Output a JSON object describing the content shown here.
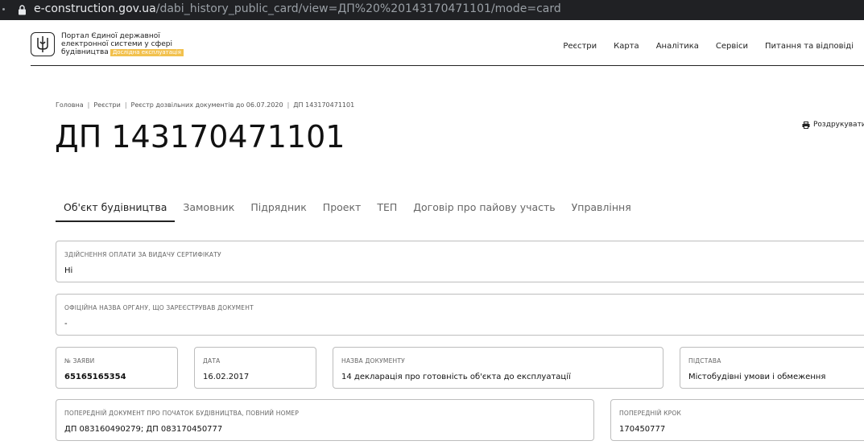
{
  "browser": {
    "url_host": "e-construction.gov.ua",
    "url_path": "/dabi_history_public_card/view=ДП%20%20143170471101/mode=card"
  },
  "header": {
    "portal_line1": "Портал Єдиної державної",
    "portal_line2": "електронної системи у сфері",
    "portal_line3": "будівництва",
    "badge": "Дослідна експлуатація",
    "nav": [
      "Реєстри",
      "Карта",
      "Аналітика",
      "Сервіси",
      "Питання та відповіді"
    ]
  },
  "breadcrumb": [
    "Головна",
    "Реєстри",
    "Реєстр дозвільних документів до 06.07.2020",
    "ДП 143170471101"
  ],
  "page": {
    "title": "ДП 143170471101",
    "print_label": "Роздрукувати"
  },
  "tabs": [
    "Об'єкт будівництва",
    "Замовник",
    "Підрядник",
    "Проект",
    "ТЕП",
    "Договір про пайову участь",
    "Управління"
  ],
  "fields": {
    "payment": {
      "label": "Здійснення оплати за видачу сертифікату",
      "value": "Ні"
    },
    "authority": {
      "label": "Офіційна назва органу, що зареєстрував документ",
      "value": "-"
    },
    "app_no": {
      "label": "№ заяви",
      "value": "65165165354"
    },
    "date": {
      "label": "Дата",
      "value": "16.02.2017"
    },
    "doc_name": {
      "label": "Назва документу",
      "value": "14 декларація про готовність об'єкта до експлуатації"
    },
    "basis": {
      "label": "Підстава",
      "value": "Містобудівні умови і обмеження"
    },
    "prev_doc": {
      "label": "Попередній документ про початок будівництва, повний номер",
      "value": "ДП 083160490279; ДП 083170450777"
    },
    "prev_step": {
      "label": "Попередній крок",
      "value": "170450777"
    }
  }
}
